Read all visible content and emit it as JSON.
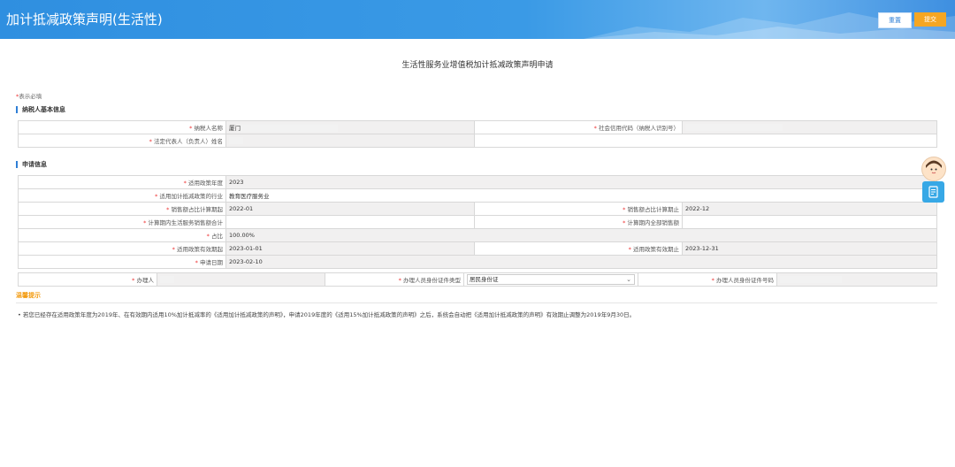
{
  "header": {
    "title": "加计抵减政策声明(生活性)",
    "reset_label": "重置",
    "submit_label": "提交"
  },
  "page_title": "生活性服务业增值税加计抵减政策声明申请",
  "required_note": {
    "star": "*",
    "text": "表示必填"
  },
  "sections": {
    "basic": "纳税人基本信息",
    "apply": "申请信息"
  },
  "basic_info": {
    "taxpayer_name_label": "纳税人名称",
    "taxpayer_name_value": "厦门",
    "credit_code_label": "社会信用代码（纳税人识别号）",
    "legal_rep_label": "法定代表人（负责人）姓名"
  },
  "apply_info": {
    "year_label": "适用政策年度",
    "year_value": "2023",
    "industry_label": "适用加计抵减政策的行业",
    "industry_value": "教育医疗服务业",
    "ratio_start_label": "销售额占比计算期起",
    "ratio_start_value": "2022-01",
    "ratio_end_label": "销售额占比计算期止",
    "ratio_end_value": "2022-12",
    "service_sales_label": "计算期内生活服务销售额合计",
    "total_sales_label": "计算期内全部销售额",
    "ratio_label": "占比",
    "ratio_value": "100.00%",
    "valid_start_label": "适用政策有效期起",
    "valid_start_value": "2023-01-01",
    "valid_end_label": "适用政策有效期止",
    "valid_end_value": "2023-12-31",
    "apply_date_label": "申请日期",
    "apply_date_value": "2023-02-10",
    "agent_label": "办理人",
    "id_type_label": "办理人员身份证件类型",
    "id_type_value": "居民身份证",
    "id_no_label": "办理人员身份证件号码"
  },
  "tips": {
    "title": "温馨提示",
    "bullet": "•",
    "text": "若您已经存在适用政策年度为2019年、在有效期内适用10%加计抵减率的《适用加计抵减政策的声明》，申请2019年度的《适用15%加计抵减政策的声明》之后，系统会自动把《适用加计抵减政策的声明》有效期止调整为2019年9月30日。"
  },
  "icons": {
    "chevron": "chevron-down-icon",
    "assistant": "assistant-avatar-icon",
    "form": "form-icon"
  }
}
